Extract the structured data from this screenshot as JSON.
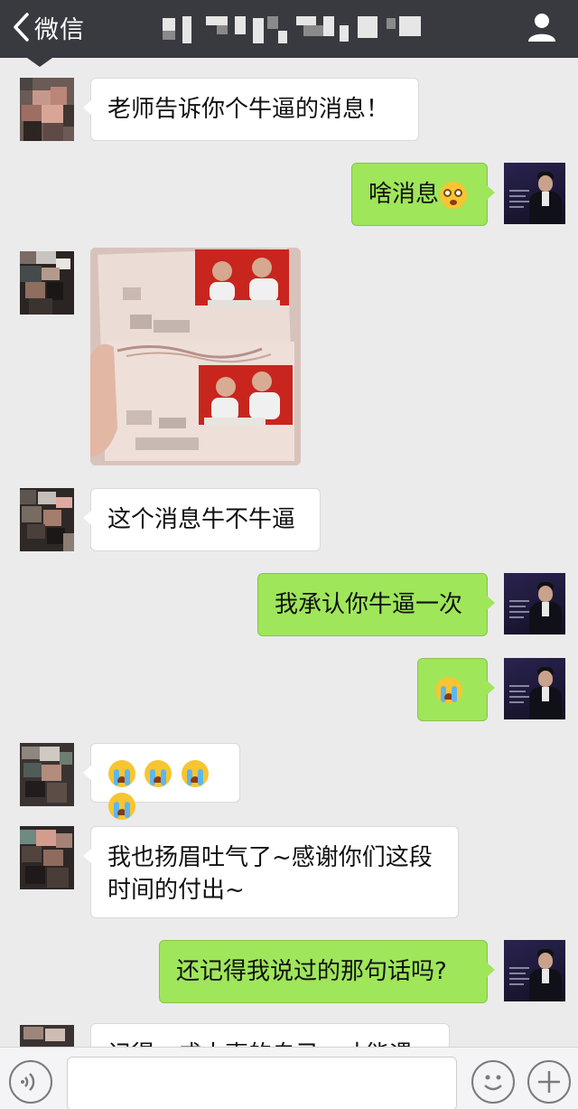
{
  "header": {
    "back_label": "微信",
    "back_icon": "chevron-left-icon",
    "profile_icon": "person-icon",
    "title_obscured": true
  },
  "messages": [
    {
      "side": "left",
      "text": "老师告诉你个牛逼的消息！"
    },
    {
      "side": "right",
      "text": "啥消息",
      "emoji": [
        "shocked-face-emoji"
      ]
    },
    {
      "side": "left",
      "type": "image",
      "description_hidden": true
    },
    {
      "side": "left",
      "text": "这个消息牛不牛逼"
    },
    {
      "side": "right",
      "text": "我承认你牛逼一次"
    },
    {
      "side": "right",
      "text": "",
      "emoji": [
        "crying-face-emoji"
      ]
    },
    {
      "side": "left",
      "text": "",
      "emoji": [
        "crying-face-emoji",
        "crying-face-emoji",
        "crying-face-emoji",
        "crying-face-emoji"
      ]
    },
    {
      "side": "left",
      "text_line1": "我也扬眉吐气了~感谢你们这段",
      "text_line2": "时间的付出~"
    },
    {
      "side": "right",
      "text": "还记得我说过的那句话吗?"
    },
    {
      "side": "left",
      "text": "记得，成大事的自己，才能遇",
      "partial": true
    }
  ],
  "input_bar": {
    "voice_icon": "voice-icon",
    "emoji_icon": "smiley-icon",
    "plus_icon": "plus-icon",
    "text_value": ""
  },
  "colors": {
    "header_bg": "#393a3f",
    "chat_bg": "#ebebeb",
    "my_bubble": "#9fe65b",
    "their_bubble": "#ffffff"
  }
}
